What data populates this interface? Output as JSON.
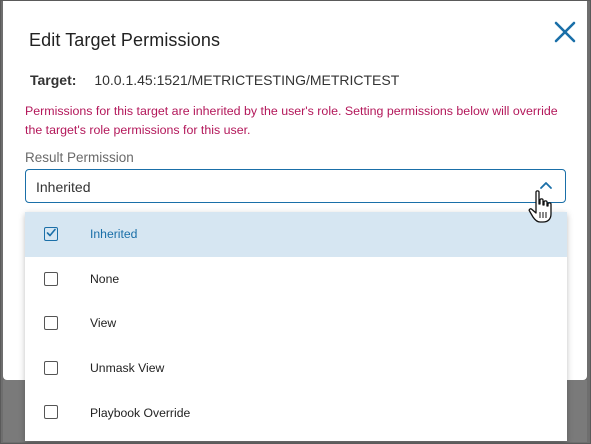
{
  "dialog": {
    "title": "Edit Target Permissions",
    "close_icon": "close-icon"
  },
  "target": {
    "label": "Target:",
    "value": "10.0.1.45:1521/METRICTESTING/METRICTEST"
  },
  "warning": {
    "text": "Permissions for this target are inherited by the user's role. Setting permissions below will override the target's role permissions for this user."
  },
  "result_permission": {
    "label": "Result Permission",
    "selected": "Inherited",
    "options": [
      {
        "label": "Inherited",
        "checked": true
      },
      {
        "label": "None",
        "checked": false
      },
      {
        "label": "View",
        "checked": false
      },
      {
        "label": "Unmask View",
        "checked": false
      },
      {
        "label": "Playbook Override",
        "checked": false
      }
    ]
  },
  "colors": {
    "accent": "#1a6fa8",
    "warning": "#b3175a",
    "selected_bg": "#d6e6f2",
    "overlay": "#6e6e6e"
  }
}
